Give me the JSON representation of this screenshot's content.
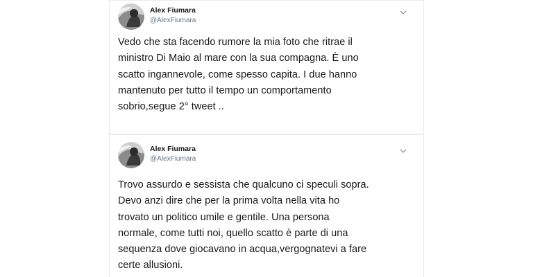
{
  "tweets": [
    {
      "author": {
        "name": "Alex Fiumara",
        "handle": "@AlexFiumara"
      },
      "text": "Vedo che sta facendo rumore la mia foto che ritrae il\nministro Di Maio al mare con la sua compagna. È uno\nscatto ingannevole, come spesso capita. I due hanno\nmantenuto per tutto il tempo un comportamento\nsobrio,segue 2° tweet .."
    },
    {
      "author": {
        "name": "Alex Fiumara",
        "handle": "@AlexFiumara"
      },
      "text": "Trovo assurdo e sessista che qualcuno ci speculi sopra.\nDevo anzi dire che per la prima volta nella vita ho\ntrovato un politico umile e gentile. Una persona\nnormale, come tutti noi, quello scatto è parte di una\nsequenza dove giocavano in acqua,vergognatevi a fare\ncerte allusioni."
    }
  ],
  "colors": {
    "text": "#14171a",
    "secondary": "#657786",
    "border": "#e6ecf0",
    "background": "#ffffff"
  },
  "icons": {
    "caret": "chevron-down-icon",
    "avatar": "user-avatar"
  }
}
